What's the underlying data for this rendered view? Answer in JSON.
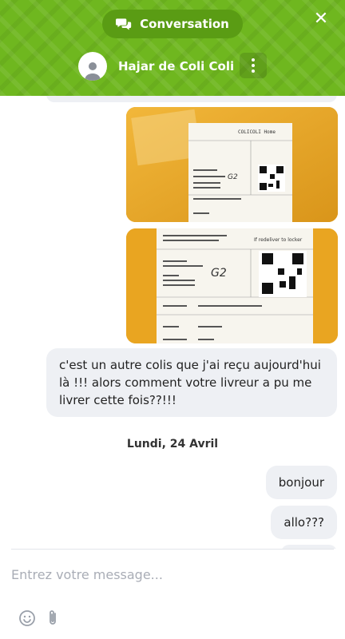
{
  "header": {
    "title": "Conversation",
    "agent_name": "Hajar de Coli Coli",
    "close_icon": "close-icon",
    "menu_icon": "more-vertical-icon",
    "chat_icon": "chat-bubbles-icon"
  },
  "messages": {
    "photos": [
      {
        "name": "package-photo-1",
        "label": "COLICOLI Home"
      },
      {
        "name": "package-photo-2",
        "label": "If redeliver to locker"
      }
    ],
    "long_text": "c'est un autre colis que j'ai reçu aujourd'hui là !!! alors comment votre livreur a pu me livrer cette fois??!!!",
    "date_separator": "Lundi, 24 Avril",
    "bonjour": "bonjour",
    "allo": "allo???"
  },
  "composer": {
    "placeholder": "Entrez votre message..."
  },
  "colors": {
    "header_green": "#6fb71f",
    "pill_green": "#5a9c14",
    "bubble_bg": "#eef0f4"
  }
}
